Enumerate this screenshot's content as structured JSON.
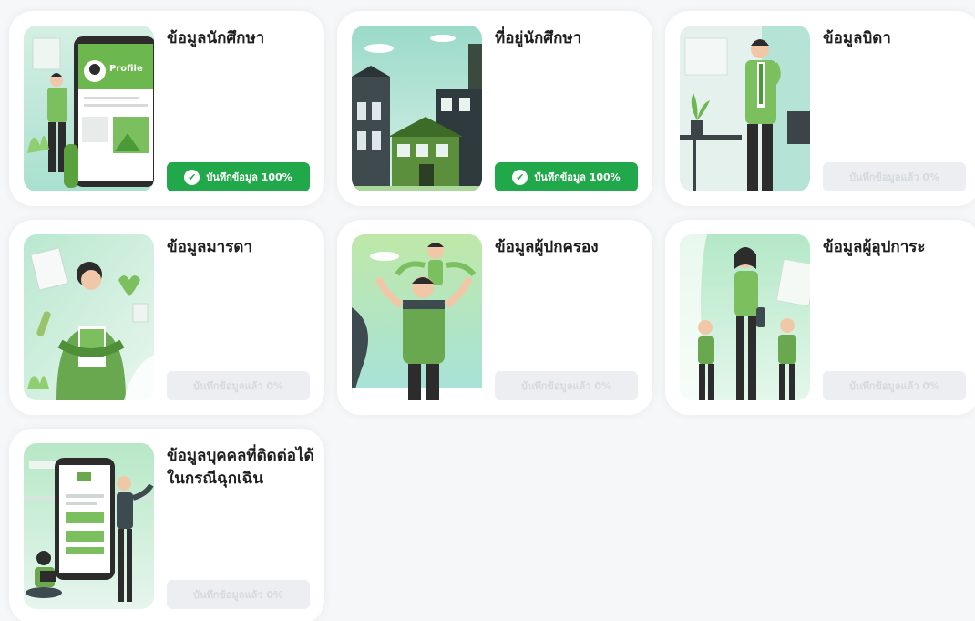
{
  "cards": [
    {
      "title": "ข้อมูลนักศึกษา",
      "status": "บันทึกข้อมูล 100%",
      "complete": true,
      "illustration_text": "Profile"
    },
    {
      "title": "ที่อยู่นักศึกษา",
      "status": "บันทึกข้อมูล 100%",
      "complete": true
    },
    {
      "title": "ข้อมูลบิดา",
      "status": "บันทึกข้อมูลแล้ว 0%",
      "complete": false
    },
    {
      "title": "ข้อมูลมารดา",
      "status": "บันทึกข้อมูลแล้ว 0%",
      "complete": false
    },
    {
      "title": "ข้อมูลผู้ปกครอง",
      "status": "บันทึกข้อมูลแล้ว 0%",
      "complete": false
    },
    {
      "title": "ข้อมูลผู้อุปการะ",
      "status": "บันทึกข้อมูลแล้ว 0%",
      "complete": false
    },
    {
      "title": "ข้อมูลบุคคลที่ติดต่อได้ในกรณีฉุกเฉิน",
      "status": "บันทึกข้อมูลแล้ว 0%",
      "complete": false
    }
  ],
  "icons": {
    "check": "check-circle-icon"
  },
  "colors": {
    "complete": "#21a84a",
    "pending": "#eceef1",
    "accent_light": "#a8e0a0"
  }
}
